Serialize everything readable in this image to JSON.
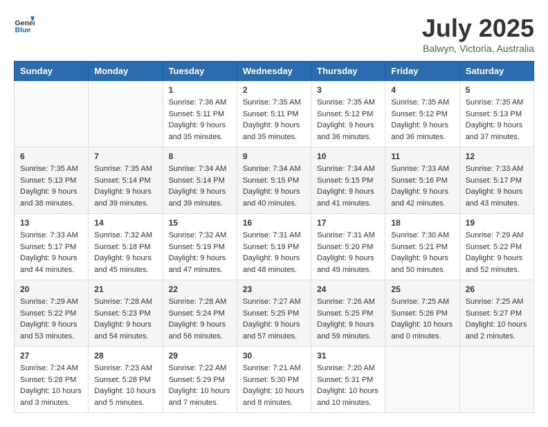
{
  "header": {
    "logo_general": "General",
    "logo_blue": "Blue",
    "month_year": "July 2025",
    "location": "Balwyn, Victoria, Australia"
  },
  "weekdays": [
    "Sunday",
    "Monday",
    "Tuesday",
    "Wednesday",
    "Thursday",
    "Friday",
    "Saturday"
  ],
  "weeks": [
    [
      {
        "date": "",
        "sunrise": "",
        "sunset": "",
        "daylight": "",
        "empty": true
      },
      {
        "date": "",
        "sunrise": "",
        "sunset": "",
        "daylight": "",
        "empty": true
      },
      {
        "date": "1",
        "sunrise": "Sunrise: 7:36 AM",
        "sunset": "Sunset: 5:11 PM",
        "daylight": "Daylight: 9 hours and 35 minutes.",
        "empty": false
      },
      {
        "date": "2",
        "sunrise": "Sunrise: 7:35 AM",
        "sunset": "Sunset: 5:11 PM",
        "daylight": "Daylight: 9 hours and 35 minutes.",
        "empty": false
      },
      {
        "date": "3",
        "sunrise": "Sunrise: 7:35 AM",
        "sunset": "Sunset: 5:12 PM",
        "daylight": "Daylight: 9 hours and 36 minutes.",
        "empty": false
      },
      {
        "date": "4",
        "sunrise": "Sunrise: 7:35 AM",
        "sunset": "Sunset: 5:12 PM",
        "daylight": "Daylight: 9 hours and 36 minutes.",
        "empty": false
      },
      {
        "date": "5",
        "sunrise": "Sunrise: 7:35 AM",
        "sunset": "Sunset: 5:13 PM",
        "daylight": "Daylight: 9 hours and 37 minutes.",
        "empty": false
      }
    ],
    [
      {
        "date": "6",
        "sunrise": "Sunrise: 7:35 AM",
        "sunset": "Sunset: 5:13 PM",
        "daylight": "Daylight: 9 hours and 38 minutes.",
        "empty": false
      },
      {
        "date": "7",
        "sunrise": "Sunrise: 7:35 AM",
        "sunset": "Sunset: 5:14 PM",
        "daylight": "Daylight: 9 hours and 39 minutes.",
        "empty": false
      },
      {
        "date": "8",
        "sunrise": "Sunrise: 7:34 AM",
        "sunset": "Sunset: 5:14 PM",
        "daylight": "Daylight: 9 hours and 39 minutes.",
        "empty": false
      },
      {
        "date": "9",
        "sunrise": "Sunrise: 7:34 AM",
        "sunset": "Sunset: 5:15 PM",
        "daylight": "Daylight: 9 hours and 40 minutes.",
        "empty": false
      },
      {
        "date": "10",
        "sunrise": "Sunrise: 7:34 AM",
        "sunset": "Sunset: 5:15 PM",
        "daylight": "Daylight: 9 hours and 41 minutes.",
        "empty": false
      },
      {
        "date": "11",
        "sunrise": "Sunrise: 7:33 AM",
        "sunset": "Sunset: 5:16 PM",
        "daylight": "Daylight: 9 hours and 42 minutes.",
        "empty": false
      },
      {
        "date": "12",
        "sunrise": "Sunrise: 7:33 AM",
        "sunset": "Sunset: 5:17 PM",
        "daylight": "Daylight: 9 hours and 43 minutes.",
        "empty": false
      }
    ],
    [
      {
        "date": "13",
        "sunrise": "Sunrise: 7:33 AM",
        "sunset": "Sunset: 5:17 PM",
        "daylight": "Daylight: 9 hours and 44 minutes.",
        "empty": false
      },
      {
        "date": "14",
        "sunrise": "Sunrise: 7:32 AM",
        "sunset": "Sunset: 5:18 PM",
        "daylight": "Daylight: 9 hours and 45 minutes.",
        "empty": false
      },
      {
        "date": "15",
        "sunrise": "Sunrise: 7:32 AM",
        "sunset": "Sunset: 5:19 PM",
        "daylight": "Daylight: 9 hours and 47 minutes.",
        "empty": false
      },
      {
        "date": "16",
        "sunrise": "Sunrise: 7:31 AM",
        "sunset": "Sunset: 5:19 PM",
        "daylight": "Daylight: 9 hours and 48 minutes.",
        "empty": false
      },
      {
        "date": "17",
        "sunrise": "Sunrise: 7:31 AM",
        "sunset": "Sunset: 5:20 PM",
        "daylight": "Daylight: 9 hours and 49 minutes.",
        "empty": false
      },
      {
        "date": "18",
        "sunrise": "Sunrise: 7:30 AM",
        "sunset": "Sunset: 5:21 PM",
        "daylight": "Daylight: 9 hours and 50 minutes.",
        "empty": false
      },
      {
        "date": "19",
        "sunrise": "Sunrise: 7:29 AM",
        "sunset": "Sunset: 5:22 PM",
        "daylight": "Daylight: 9 hours and 52 minutes.",
        "empty": false
      }
    ],
    [
      {
        "date": "20",
        "sunrise": "Sunrise: 7:29 AM",
        "sunset": "Sunset: 5:22 PM",
        "daylight": "Daylight: 9 hours and 53 minutes.",
        "empty": false
      },
      {
        "date": "21",
        "sunrise": "Sunrise: 7:28 AM",
        "sunset": "Sunset: 5:23 PM",
        "daylight": "Daylight: 9 hours and 54 minutes.",
        "empty": false
      },
      {
        "date": "22",
        "sunrise": "Sunrise: 7:28 AM",
        "sunset": "Sunset: 5:24 PM",
        "daylight": "Daylight: 9 hours and 56 minutes.",
        "empty": false
      },
      {
        "date": "23",
        "sunrise": "Sunrise: 7:27 AM",
        "sunset": "Sunset: 5:25 PM",
        "daylight": "Daylight: 9 hours and 57 minutes.",
        "empty": false
      },
      {
        "date": "24",
        "sunrise": "Sunrise: 7:26 AM",
        "sunset": "Sunset: 5:25 PM",
        "daylight": "Daylight: 9 hours and 59 minutes.",
        "empty": false
      },
      {
        "date": "25",
        "sunrise": "Sunrise: 7:25 AM",
        "sunset": "Sunset: 5:26 PM",
        "daylight": "Daylight: 10 hours and 0 minutes.",
        "empty": false
      },
      {
        "date": "26",
        "sunrise": "Sunrise: 7:25 AM",
        "sunset": "Sunset: 5:27 PM",
        "daylight": "Daylight: 10 hours and 2 minutes.",
        "empty": false
      }
    ],
    [
      {
        "date": "27",
        "sunrise": "Sunrise: 7:24 AM",
        "sunset": "Sunset: 5:28 PM",
        "daylight": "Daylight: 10 hours and 3 minutes.",
        "empty": false
      },
      {
        "date": "28",
        "sunrise": "Sunrise: 7:23 AM",
        "sunset": "Sunset: 5:28 PM",
        "daylight": "Daylight: 10 hours and 5 minutes.",
        "empty": false
      },
      {
        "date": "29",
        "sunrise": "Sunrise: 7:22 AM",
        "sunset": "Sunset: 5:29 PM",
        "daylight": "Daylight: 10 hours and 7 minutes.",
        "empty": false
      },
      {
        "date": "30",
        "sunrise": "Sunrise: 7:21 AM",
        "sunset": "Sunset: 5:30 PM",
        "daylight": "Daylight: 10 hours and 8 minutes.",
        "empty": false
      },
      {
        "date": "31",
        "sunrise": "Sunrise: 7:20 AM",
        "sunset": "Sunset: 5:31 PM",
        "daylight": "Daylight: 10 hours and 10 minutes.",
        "empty": false
      },
      {
        "date": "",
        "sunrise": "",
        "sunset": "",
        "daylight": "",
        "empty": true
      },
      {
        "date": "",
        "sunrise": "",
        "sunset": "",
        "daylight": "",
        "empty": true
      }
    ]
  ]
}
